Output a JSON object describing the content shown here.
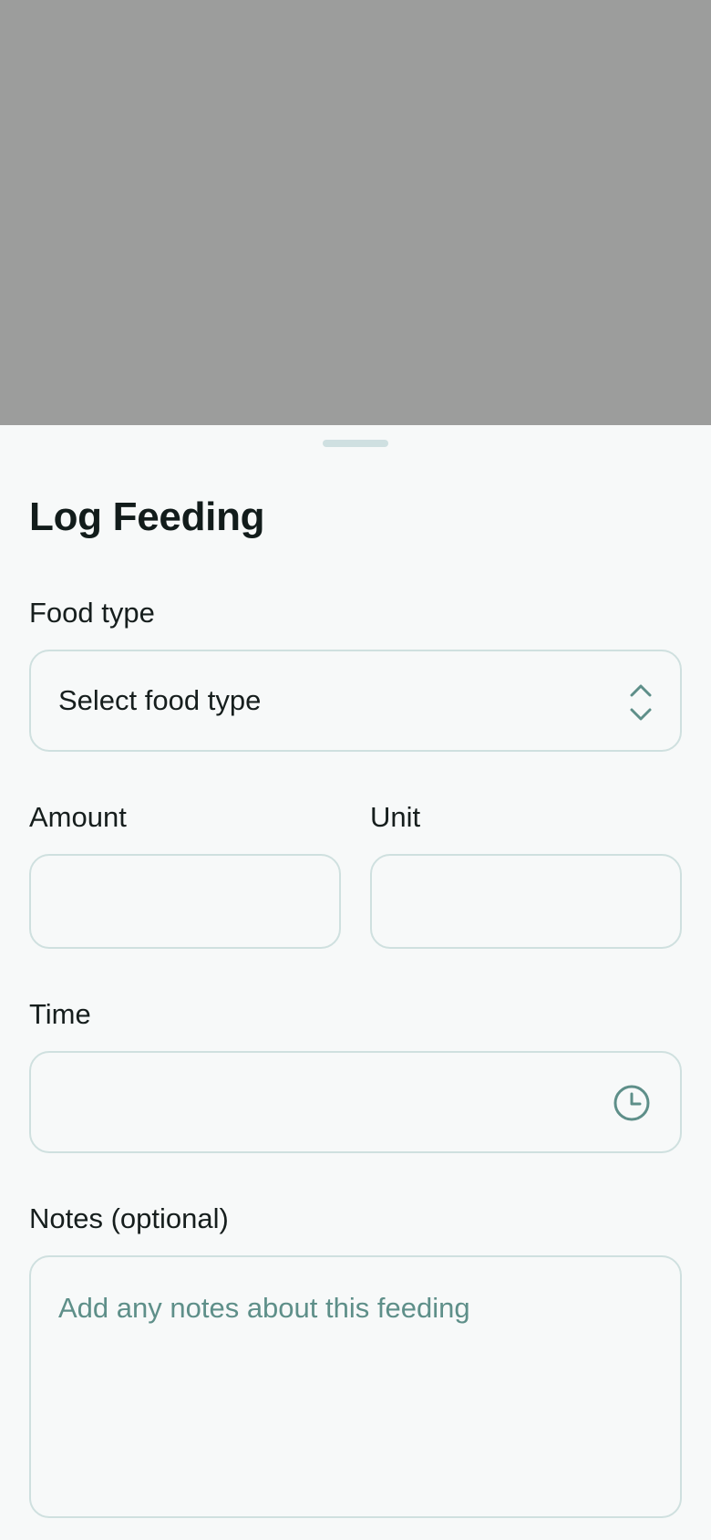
{
  "sheet": {
    "title": "Log Feeding"
  },
  "food_type": {
    "label": "Food type",
    "selected": "Select food type",
    "icon": "chevron-up-down-icon"
  },
  "amount": {
    "label": "Amount",
    "value": ""
  },
  "unit": {
    "label": "Unit",
    "value": ""
  },
  "time": {
    "label": "Time",
    "value": "",
    "icon": "clock-icon"
  },
  "notes": {
    "label": "Notes (optional)",
    "placeholder": "Add any notes about this feeding",
    "value": ""
  },
  "colors": {
    "accent": "#5e8f89",
    "border": "#cfe0df",
    "sheet_bg": "#f7f9f9",
    "overlay": "#9c9d9c",
    "text": "#161e1d"
  }
}
